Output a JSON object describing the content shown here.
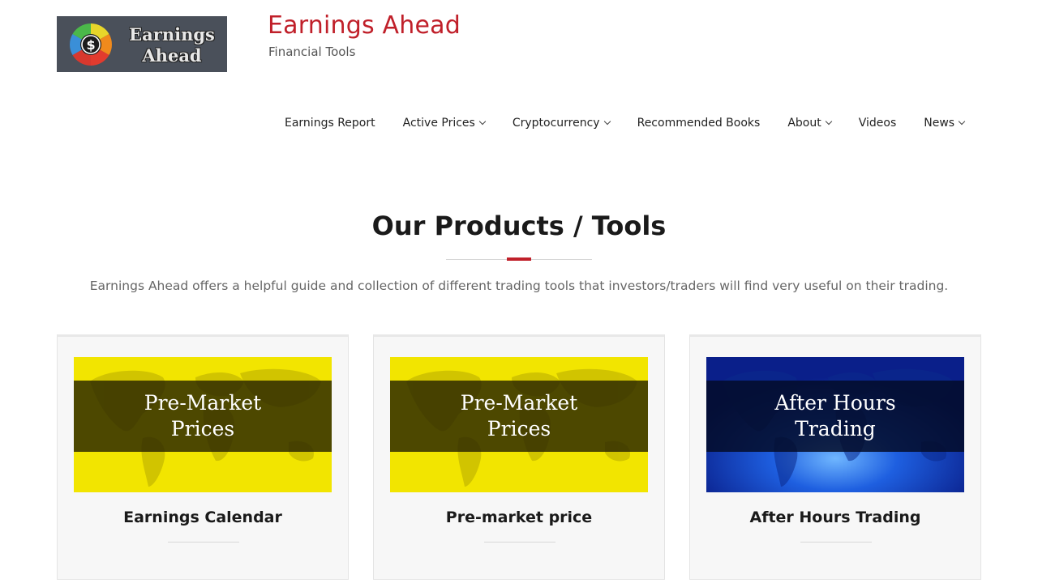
{
  "header": {
    "logo_text_line1": "Earnings",
    "logo_text_line2": "Ahead",
    "title": "Earnings Ahead",
    "tagline": "Financial Tools"
  },
  "nav": {
    "items": [
      {
        "label": "Earnings Report",
        "dropdown": false
      },
      {
        "label": "Active Prices",
        "dropdown": true
      },
      {
        "label": "Cryptocurrency",
        "dropdown": true
      },
      {
        "label": "Recommended Books",
        "dropdown": false
      },
      {
        "label": "About",
        "dropdown": true
      },
      {
        "label": "Videos",
        "dropdown": false
      },
      {
        "label": "News",
        "dropdown": true
      }
    ]
  },
  "section": {
    "title": "Our Products / Tools",
    "description": "Earnings Ahead offers a helpful guide and collection of different trading tools that investors/traders will find very useful on their trading."
  },
  "cards": [
    {
      "image_line1": "Pre-Market",
      "image_line2": "Prices",
      "title": "Earnings Calendar",
      "theme": "yellow"
    },
    {
      "image_line1": "Pre-Market",
      "image_line2": "Prices",
      "title": "Pre-market price",
      "theme": "yellow"
    },
    {
      "image_line1": "After Hours",
      "image_line2": "Trading",
      "title": "After Hours Trading",
      "theme": "blue"
    }
  ],
  "colors": {
    "brand_red": "#c0202a",
    "yellow": "#f2e500",
    "blue": "#1437a8"
  }
}
